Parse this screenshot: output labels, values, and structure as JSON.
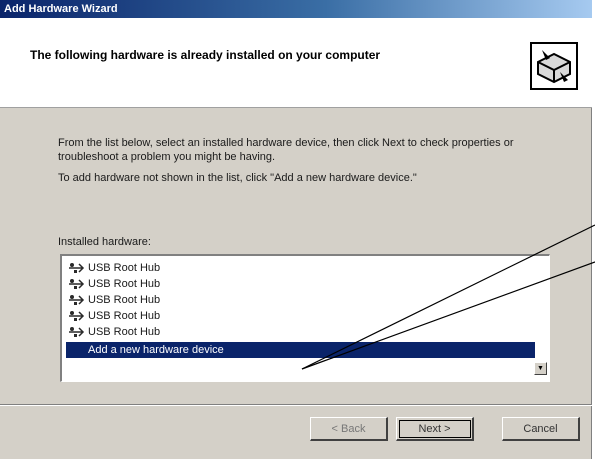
{
  "window": {
    "title": "Add Hardware Wizard"
  },
  "header": {
    "title": "The following hardware is already installed on your computer",
    "icon": "hardware-wizard-icon"
  },
  "body": {
    "instructions": "From the list below, select an installed hardware device, then click Next to check properties or troubleshoot a problem you might be having.",
    "add_hint": "To add hardware not shown in the list, click \"Add a new hardware device.\"",
    "list_label": "Installed hardware:"
  },
  "installed_hardware": [
    {
      "label": "USB Root Hub",
      "icon": "usb-icon"
    },
    {
      "label": "USB Root Hub",
      "icon": "usb-icon"
    },
    {
      "label": "USB Root Hub",
      "icon": "usb-icon"
    },
    {
      "label": "USB Root Hub",
      "icon": "usb-icon"
    },
    {
      "label": "USB Root Hub",
      "icon": "usb-icon"
    }
  ],
  "selected_item": {
    "label": "Add a new hardware device"
  },
  "buttons": {
    "back": "< Back",
    "next": "Next >",
    "cancel": "Cancel"
  },
  "colors": {
    "selection": "#0a246a",
    "dialog_bg": "#d4d0c8",
    "title_gradient_start": "#0a246a"
  }
}
